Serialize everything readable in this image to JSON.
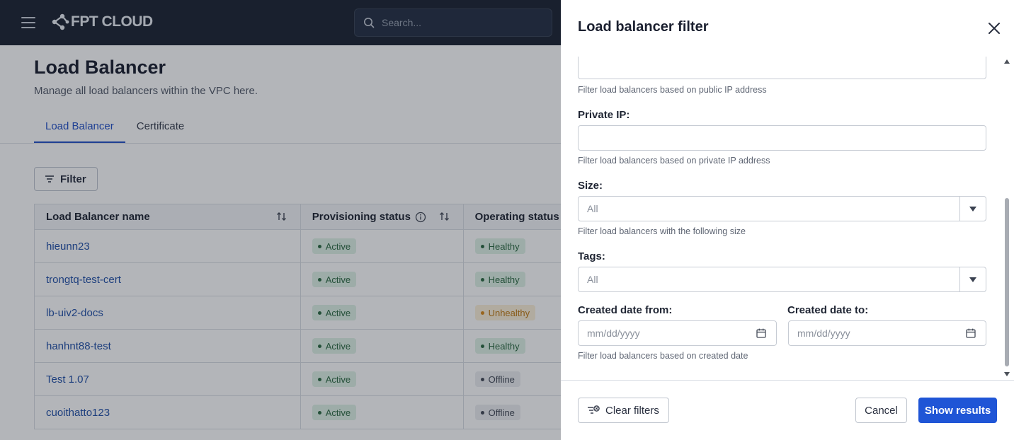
{
  "topbar": {
    "logo_text": "FPT CLOUD",
    "search_placeholder": "Search..."
  },
  "page": {
    "title": "Load Balancer",
    "subtitle": "Manage all load balancers within the VPC here.",
    "tabs": [
      {
        "label": "Load Balancer",
        "active": true
      },
      {
        "label": "Certificate",
        "active": false
      }
    ],
    "filter_label": "Filter"
  },
  "table": {
    "columns": [
      "Load Balancer name",
      "Provisioning status",
      "Operating status"
    ],
    "rows": [
      {
        "name": "hieunn23",
        "provisioning": "Active",
        "operating": "Healthy"
      },
      {
        "name": "trongtq-test-cert",
        "provisioning": "Active",
        "operating": "Healthy"
      },
      {
        "name": "lb-uiv2-docs",
        "provisioning": "Active",
        "operating": "Unhealthy"
      },
      {
        "name": "hanhnt88-test",
        "provisioning": "Active",
        "operating": "Healthy"
      },
      {
        "name": "Test 1.07",
        "provisioning": "Active",
        "operating": "Offline"
      },
      {
        "name": "cuoithatto123",
        "provisioning": "Active",
        "operating": "Offline"
      }
    ]
  },
  "drawer": {
    "title": "Load balancer filter",
    "public_ip_help": "Filter load balancers based on public IP address",
    "private_ip_label": "Private IP:",
    "private_ip_value": "",
    "private_ip_help": "Filter load balancers based on private IP address",
    "size_label": "Size:",
    "size_value": "All",
    "size_help": "Filter load balancers with the following size",
    "tags_label": "Tags:",
    "tags_value": "All",
    "created_from_label": "Created date from:",
    "created_to_label": "Created date to:",
    "date_placeholder": "mm/dd/yyyy",
    "created_help": "Filter load balancers based on created date",
    "clear_filters": "Clear filters",
    "cancel": "Cancel",
    "show_results": "Show results"
  },
  "colors": {
    "topbar": "#1c2433",
    "accent": "#1f55d6",
    "healthy": "#2d6a43",
    "unhealthy": "#c07a12",
    "offline": "#444b58"
  }
}
